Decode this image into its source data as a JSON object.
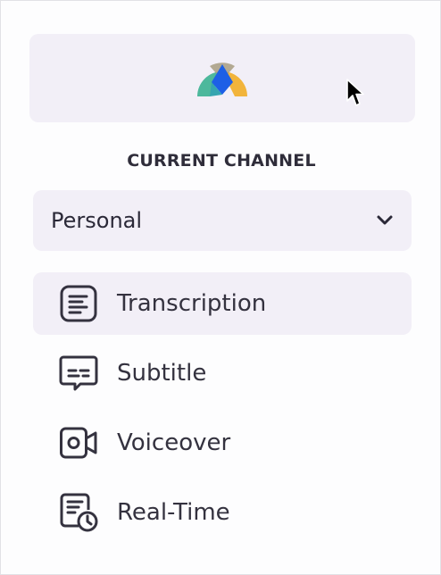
{
  "brand": {
    "logo_icon": "app-logo",
    "colors": [
      "#4db89c",
      "#1d5fe6",
      "#f2b43b",
      "#a89c80"
    ]
  },
  "channel": {
    "section_label": "CURRENT CHANNEL",
    "selected": "Personal",
    "dropdown_icon": "chevron-down-icon"
  },
  "nav": {
    "items": [
      {
        "label": "Transcription",
        "icon": "document-lines-icon",
        "active": true
      },
      {
        "label": "Subtitle",
        "icon": "subtitle-icon",
        "active": false
      },
      {
        "label": "Voiceover",
        "icon": "video-camera-icon",
        "active": false
      },
      {
        "label": "Real-Time",
        "icon": "document-clock-icon",
        "active": false
      }
    ]
  },
  "theme": {
    "accent_bg": "#f2eff7",
    "text": "#34323f"
  }
}
